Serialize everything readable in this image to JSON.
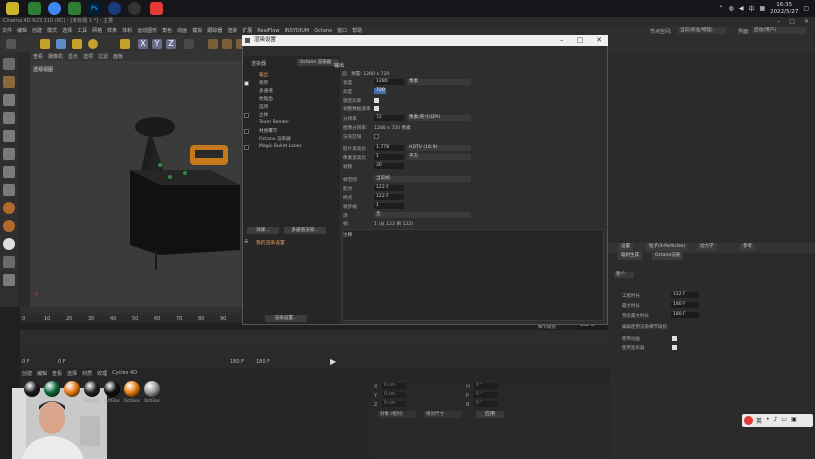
{
  "taskbar": {
    "clock_time": "16:35",
    "clock_date": "2022/5/27",
    "app_colors": [
      "#2f7d32",
      "#e53935",
      "#fbc02d",
      "#1e88e5",
      "#31a8ff",
      "#5a5a5a",
      "#808080",
      "#e53935"
    ]
  },
  "window": {
    "title": "Cinema 4D R23.110 (RC) - [未标题 1 *] - 主要"
  },
  "menubar": {
    "items": [
      "文件",
      "编辑",
      "创建",
      "模式",
      "选择",
      "工具",
      "网格",
      "样条",
      "体积",
      "运动图形",
      "角色",
      "动画",
      "模拟",
      "跟踪器",
      "渲染",
      "扩展",
      "RealFlow",
      "INSYDIUM",
      "Octane",
      "窗口",
      "帮助"
    ]
  },
  "right_header": {
    "node_space_label": "节点空间:",
    "node_space_value": "当前(标准/物理)",
    "layout_label": "界面:",
    "layout_value": "启动(用户)"
  },
  "viewport": {
    "menu": [
      "查看",
      "摄像机",
      "显示",
      "选项",
      "过滤",
      "面板"
    ],
    "label": "透视视图"
  },
  "ruler": {
    "ticks": [
      "0",
      "10",
      "20",
      "30",
      "40",
      "50",
      "60",
      "70",
      "80",
      "90"
    ]
  },
  "dialog": {
    "title": "渲染设置",
    "renderer_label": "渲染器",
    "renderer_value": "Octane 渲染器",
    "tree": [
      {
        "label": "输出",
        "checked": false
      },
      {
        "label": "保存",
        "checked": true
      },
      {
        "label": "多通道",
        "checked": false
      },
      {
        "label": "抗锯齿",
        "checked": false
      },
      {
        "label": "选项",
        "checked": false
      },
      {
        "label": "立体",
        "checked": false
      },
      {
        "label": "Team Render",
        "checked": false
      },
      {
        "label": "材质覆写",
        "checked": false
      },
      {
        "label": "Octane 渲染器",
        "checked": false
      },
      {
        "label": "Magic Bullet Looks",
        "checked": false
      }
    ],
    "btn_effects": "效果...",
    "btn_multipass": "多通道渲染...",
    "my_settings": "我的渲染设置",
    "btn_render_settings": "渲染设置...",
    "out_title": "输出",
    "preset": "预置: 1280 x 720",
    "fields": {
      "width_label": "宽度",
      "width_val": "1280",
      "width_unit": "像素",
      "height_label": "高度",
      "height_val": "720",
      "lock_label": "锁定比率",
      "adapt_label": "调整数据速率",
      "res_label": "分辨率",
      "res_val": "72",
      "res_unit": "像素/英寸(DPI)",
      "imgres_label": "图像分辨率:",
      "imgres_val": "1280 x 720 像素",
      "region_label": "渲染区域",
      "film_label": "胶片宽高比",
      "film_val": "1.778",
      "film_sel": "HDTV (16:9)",
      "pixel_label": "像素宽高比",
      "pixel_val": "1",
      "pixel_sel": "平方",
      "fps_label": "帧频",
      "fps_val": "30",
      "frame_range_label": "帧范围",
      "frame_range_sel": "当前帧",
      "start_label": "起点",
      "start_val": "122 F",
      "end_label": "终点",
      "end_val": "122 F",
      "step_label": "帧步幅",
      "step_val": "1",
      "field_label": "场",
      "field_sel": "无",
      "frames_label": "帧:",
      "frames_val": "1 (从 122 到 122)"
    },
    "note_label": "注释"
  },
  "right_panel": {
    "tabs": [
      "设置",
      "粒子(X-Particles)",
      "动力学",
      "参考"
    ],
    "sub_tabs": [
      "辐射生成",
      "Octane渲染"
    ],
    "mode_label": "整个",
    "params": [
      {
        "label": "工程时长",
        "value": "122 F"
      },
      {
        "label": "最大时长",
        "value": "180 F"
      },
      {
        "label": "预览最大时长",
        "value": "180 F"
      }
    ],
    "lod_label": "细节级别",
    "lod_value": "100 %",
    "editor_lod": "编辑使用渲染细节级别",
    "check_rows": [
      {
        "label": "使用表达式",
        "checked": true
      },
      {
        "label": "使用动画",
        "checked": true
      },
      {
        "label": "使用生成器",
        "checked": true
      },
      {
        "label": "使用变形器",
        "checked": true
      },
      {
        "label": "使用运动剪辑系统",
        "checked": true
      }
    ],
    "default_color_label": "默认对象颜色",
    "default_color_val": "60% 灰色",
    "color_label": "颜色",
    "view_clip_label": "视图修剪",
    "view_clip_val": "中",
    "linear_label": "线性工作流程",
    "input_color_label": "输入色彩特性",
    "input_color_val": "sRGB",
    "multi_label": "为节点材质使用颜色通道",
    "btn_load": "载入预设...",
    "btn_save": "保存预设..."
  },
  "materials": {
    "menu": [
      "创建",
      "编辑",
      "查看",
      "选择",
      "材质",
      "纹理",
      "Cycles 4D"
    ],
    "items": [
      {
        "label": "",
        "color": "#1a1a1a"
      },
      {
        "label": "",
        "color": "#0f6b3c"
      },
      {
        "label": "",
        "color": "#e47914"
      },
      {
        "label": "OctGlos",
        "color": "#222"
      },
      {
        "label": "OctGlos",
        "color": "#111"
      },
      {
        "label": "OctGlos",
        "color": "#e77e12"
      },
      {
        "label": "OctGlos",
        "color": "#9a9a9a"
      }
    ]
  },
  "timeline": {
    "frame_left": "0 F",
    "frame_start": "0 F",
    "frame_end": "180 F",
    "frame_end2": "180 F",
    "frame_right": "122 F"
  },
  "coords": {
    "labels": [
      "X",
      "Y",
      "Z"
    ],
    "vals": [
      "0 cm",
      "0 cm",
      "0 cm"
    ],
    "rot": [
      "H",
      "P",
      "B"
    ],
    "rot_vals": [
      "0 °",
      "0 °",
      "0 °"
    ],
    "mode1": "对象 (相对)",
    "mode2": "绝对尺寸",
    "apply": "应用"
  }
}
